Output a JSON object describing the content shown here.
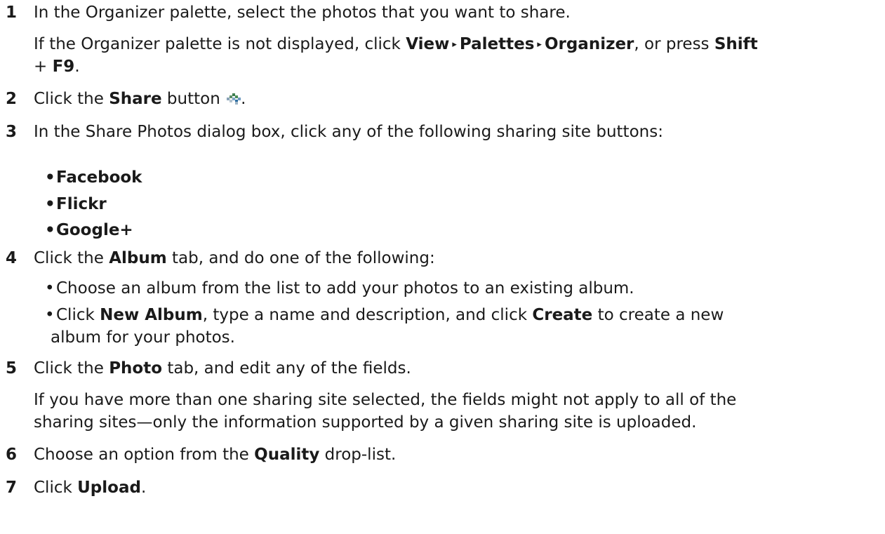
{
  "steps": [
    {
      "num": "1",
      "text": "In the Organizer palette, select the photos that you want to share."
    },
    {
      "num": "2",
      "pre": "Click the ",
      "bold": "Share",
      "post": " button",
      "end": "."
    },
    {
      "num": "3",
      "text": "In the Share Photos dialog box, click any of the following sharing site buttons:"
    },
    {
      "num": "4",
      "pre": "Click the ",
      "bold": "Album",
      "post": " tab, and do one of the following:"
    },
    {
      "num": "5",
      "pre": "Click the ",
      "bold": "Photo",
      "post": " tab, and edit any of the fields."
    },
    {
      "num": "6",
      "pre": "Choose an option from the ",
      "bold": "Quality",
      "post": " drop-list."
    },
    {
      "num": "7",
      "pre": "Click ",
      "bold": "Upload",
      "post": "."
    }
  ],
  "note1": {
    "pre": "If the Organizer palette is not displayed, click ",
    "m1": "View",
    "arrow": "▸",
    "m2": "Palettes",
    "m3": "Organizer",
    "mid": ", or press ",
    "k1": "Shift",
    "plus": "+ ",
    "k2": "F9",
    "end": "."
  },
  "sites": [
    "Facebook",
    "Flickr",
    "Google+"
  ],
  "album_options": {
    "opt1": "Choose an album from the list to add your photos to an existing album.",
    "opt2_pre": "Click ",
    "opt2_b1": "New Album",
    "opt2_mid": ", type a name and description, and click ",
    "opt2_b2": "Create",
    "opt2_end": " to create a new",
    "opt2_line2": "album for your photos."
  },
  "note5": {
    "line1": "If you have more than one sharing site selected, the fields might not apply to all of the",
    "line2": "sharing sites—only the information supported by a given sharing site is uploaded."
  },
  "bullet_char": "•",
  "icons": {
    "share": "share-icon"
  }
}
